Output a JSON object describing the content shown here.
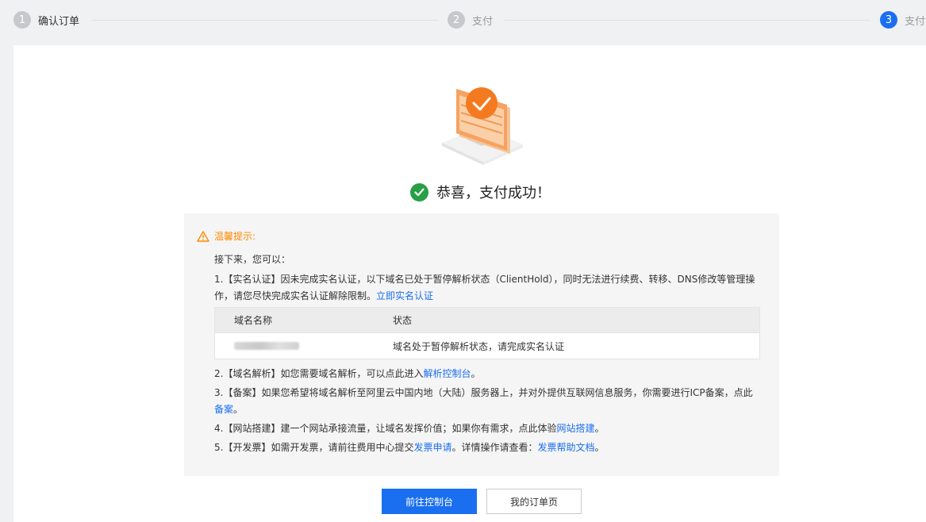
{
  "steps": [
    {
      "num": "1",
      "label": "确认订单"
    },
    {
      "num": "2",
      "label": "支付"
    },
    {
      "num": "3",
      "label": "支付"
    }
  ],
  "success": {
    "text": "恭喜，支付成功！"
  },
  "tips": {
    "title": "温馨提示:",
    "intro": "接下来，您可以：",
    "item1_text": "1.【实名认证】因未完成实名认证，以下域名已处于暂停解析状态（ClientHold），同时无法进行续费、转移、DNS修改等管理操作，请您尽快完成实名认证解除限制。",
    "item1_link": "立即实名认证",
    "table": {
      "headers": [
        "域名名称",
        "状态"
      ],
      "rows": [
        {
          "domain": "",
          "status": "域名处于暂停解析状态，请完成实名认证"
        }
      ]
    },
    "item2_text": "2.【域名解析】如您需要域名解析，可以点此进入",
    "item2_link": "解析控制台",
    "item2_end": "。",
    "item3_text": "3.【备案】如果您希望将域名解析至阿里云中国内地（大陆）服务器上，并对外提供互联网信息服务，你需要进行ICP备案，点此",
    "item3_link": "备案",
    "item3_end": "。",
    "item4_text": "4.【网站搭建】建一个网站承接流量，让域名发挥价值；如果你有需求，点此体验",
    "item4_link": "网站搭建",
    "item4_end": "。",
    "item5_text": "5.【开发票】如需开发票，请前往费用中心提交",
    "item5_link1": "发票申请",
    "item5_mid": "。详情操作请查看：",
    "item5_link2": "发票帮助文档",
    "item5_end": "。"
  },
  "buttons": {
    "primary": "前往控制台",
    "secondary": "我的订单页"
  },
  "colors": {
    "accent": "#1a6ff0",
    "success": "#27a046",
    "warning": "#ff8a00",
    "illustration": "#f47a20"
  },
  "icons": [
    "warning-icon",
    "check-circle-icon",
    "payment-success-illustration"
  ]
}
